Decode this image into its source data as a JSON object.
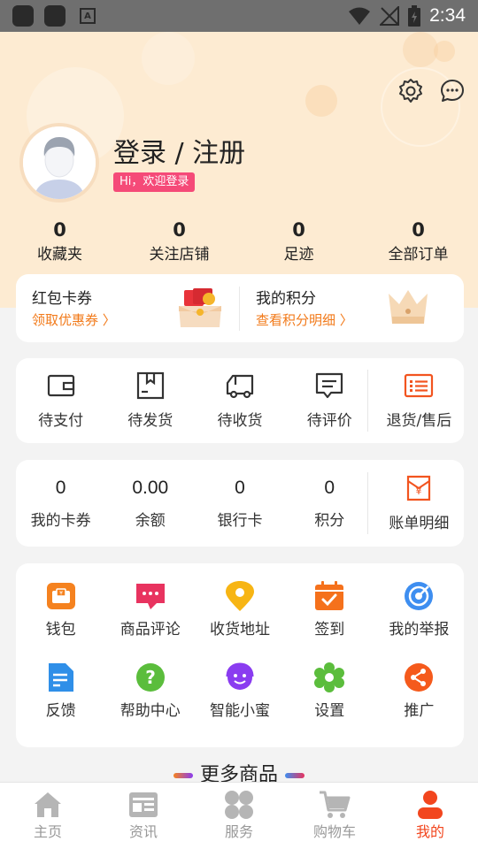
{
  "status_bar": {
    "time": "2:34",
    "app_badge": "A"
  },
  "profile": {
    "login_text": "登录 / 注册",
    "welcome_badge": "Hi，欢迎登录"
  },
  "stats": [
    {
      "value": "0",
      "label": "收藏夹"
    },
    {
      "value": "0",
      "label": "关注店铺"
    },
    {
      "value": "0",
      "label": "足迹"
    },
    {
      "value": "0",
      "label": "全部订单"
    }
  ],
  "promo": {
    "coupon": {
      "title": "红包卡券",
      "link": "领取优惠券 〉"
    },
    "points": {
      "title": "我的积分",
      "link": "查看积分明细 〉"
    }
  },
  "orders": [
    {
      "label": "待支付",
      "icon": "wallet-icon"
    },
    {
      "label": "待发货",
      "icon": "box-icon"
    },
    {
      "label": "待收货",
      "icon": "truck-icon"
    },
    {
      "label": "待评价",
      "icon": "comment-icon"
    },
    {
      "label": "退货/售后",
      "icon": "list-icon"
    }
  ],
  "assets": [
    {
      "value": "0",
      "label": "我的卡券"
    },
    {
      "value": "0.00",
      "label": "余额"
    },
    {
      "value": "0",
      "label": "银行卡"
    },
    {
      "value": "0",
      "label": "积分"
    },
    {
      "label": "账单明细",
      "icon": "bill-icon"
    }
  ],
  "tools": [
    {
      "label": "钱包",
      "icon": "wallet-icon",
      "color": "#f5821f"
    },
    {
      "label": "商品评论",
      "icon": "chat-icon",
      "color": "#e8335f"
    },
    {
      "label": "收货地址",
      "icon": "location-icon",
      "color": "#f7b514"
    },
    {
      "label": "签到",
      "icon": "calendar-icon",
      "color": "#f5711c"
    },
    {
      "label": "我的举报",
      "icon": "target-icon",
      "color": "#3e8ef0"
    },
    {
      "label": "反馈",
      "icon": "document-icon",
      "color": "#2f8fe8"
    },
    {
      "label": "帮助中心",
      "icon": "question-icon",
      "color": "#5bbd3c"
    },
    {
      "label": "智能小蜜",
      "icon": "assistant-icon",
      "color": "#8a3cf0"
    },
    {
      "label": "设置",
      "icon": "settings-icon",
      "color": "#5bbd3c"
    },
    {
      "label": "推广",
      "icon": "share-icon",
      "color": "#f55a1c"
    }
  ],
  "more_section": {
    "title": "更多商品"
  },
  "tabbar": [
    {
      "label": "主页",
      "icon": "home-icon",
      "active": false
    },
    {
      "label": "资讯",
      "icon": "news-icon",
      "active": false
    },
    {
      "label": "服务",
      "icon": "grid-icon",
      "active": false
    },
    {
      "label": "购物车",
      "icon": "cart-icon",
      "active": false
    },
    {
      "label": "我的",
      "icon": "user-icon",
      "active": true
    }
  ]
}
